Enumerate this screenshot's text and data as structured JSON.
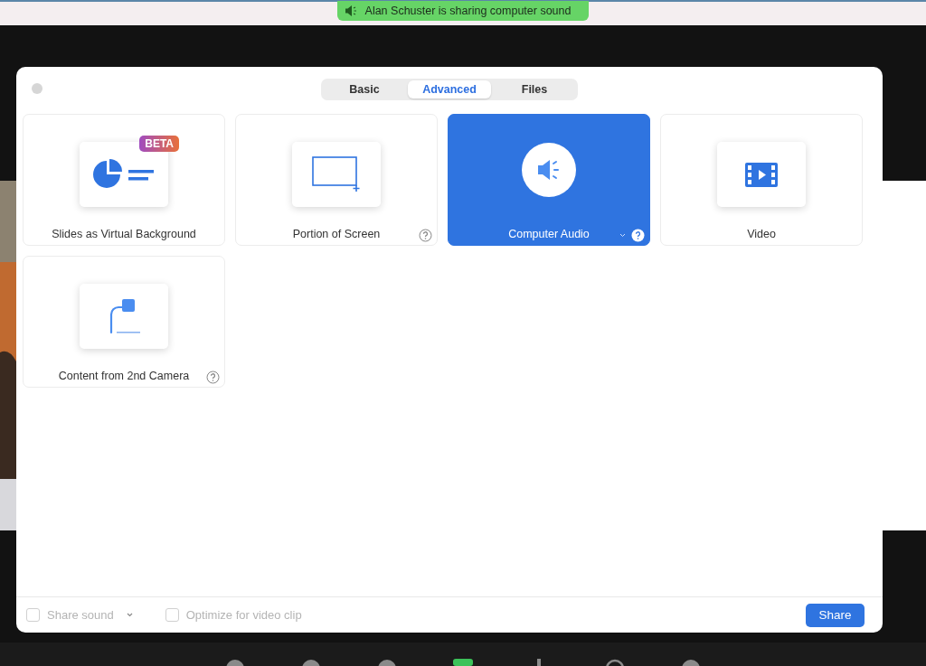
{
  "banner": {
    "text": "Alan Schuster is sharing computer sound"
  },
  "dialog": {
    "tabs": [
      {
        "label": "Basic",
        "selected": false
      },
      {
        "label": "Advanced",
        "selected": true
      },
      {
        "label": "Files",
        "selected": false
      }
    ],
    "tiles": [
      {
        "label": "Slides as Virtual Background",
        "kind": "slides",
        "selected": false,
        "badge": "BETA",
        "help": false,
        "dropdown": false
      },
      {
        "label": "Portion of Screen",
        "kind": "portion",
        "selected": false,
        "help": true,
        "dropdown": false
      },
      {
        "label": "Computer Audio",
        "kind": "audio",
        "selected": true,
        "help": true,
        "dropdown": true
      },
      {
        "label": "Video",
        "kind": "video",
        "selected": false,
        "help": false,
        "dropdown": false
      },
      {
        "label": "Content from 2nd Camera",
        "kind": "camera",
        "selected": false,
        "help": true,
        "dropdown": false
      }
    ],
    "options": [
      {
        "label": "Share sound",
        "checked": false,
        "disabled": true,
        "dropdown": true
      },
      {
        "label": "Optimize for video clip",
        "checked": false,
        "disabled": true,
        "dropdown": false
      }
    ],
    "share_button": "Share"
  }
}
